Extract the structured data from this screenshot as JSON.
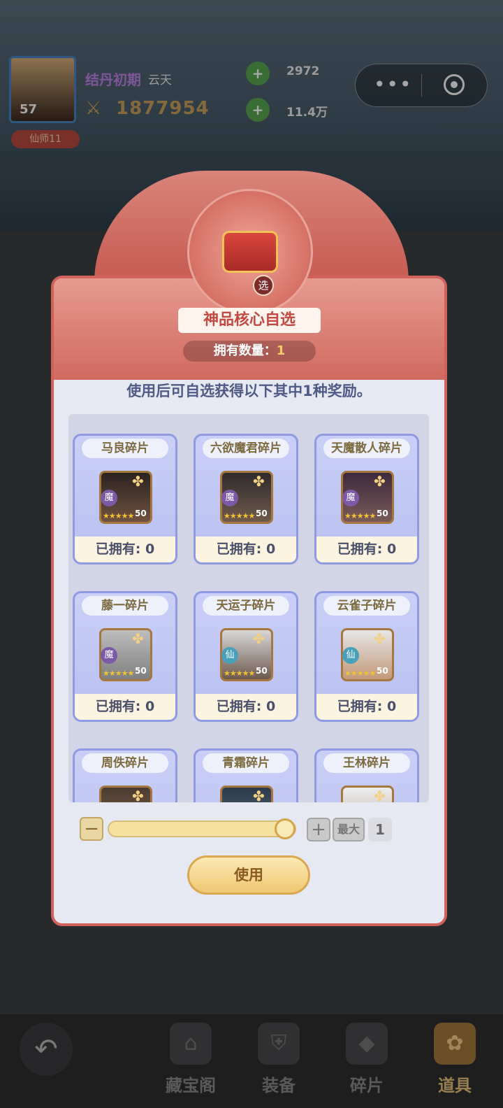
{
  "header": {
    "player_level": "57",
    "title_badge": "仙师11",
    "realm": "结丹初期",
    "player_name": "云天",
    "power": "1877954",
    "resource_1": "2972",
    "resource_2": "11.4万"
  },
  "modal": {
    "title": "神品核心自选",
    "chest_badge": "选",
    "owned_label": "拥有数量：",
    "owned_count": "1",
    "description": "使用后可自选获得以下其中1种奖励。",
    "items": [
      {
        "name": "马良碎片",
        "faction": "魔",
        "qty": "50",
        "owned": "已拥有: 0"
      },
      {
        "name": "六欲魔君碎片",
        "faction": "魔",
        "qty": "50",
        "owned": "已拥有: 0"
      },
      {
        "name": "天魔散人碎片",
        "faction": "魔",
        "qty": "50",
        "owned": "已拥有: 0"
      },
      {
        "name": "藤一碎片",
        "faction": "魔",
        "qty": "50",
        "owned": "已拥有: 0"
      },
      {
        "name": "天运子碎片",
        "faction": "仙",
        "qty": "50",
        "owned": "已拥有: 0"
      },
      {
        "name": "云雀子碎片",
        "faction": "仙",
        "qty": "50",
        "owned": "已拥有: 0"
      },
      {
        "name": "周佚碎片"
      },
      {
        "name": "青霜碎片"
      },
      {
        "name": "王林碎片"
      }
    ],
    "selector": {
      "minus": "−",
      "plus": "+",
      "max_label": "最大",
      "count": "1",
      "fraction": 1.0
    },
    "use_label": "使用"
  },
  "nav": {
    "items": [
      {
        "label": "藏宝阁",
        "icon": "pavilion-icon"
      },
      {
        "label": "装备",
        "icon": "armor-icon"
      },
      {
        "label": "碎片",
        "icon": "shard-icon"
      },
      {
        "label": "道具",
        "icon": "bag-icon"
      }
    ]
  },
  "colors": {
    "modal_border": "#d0615b",
    "card_border": "#8f9ae3",
    "accent_gold": "#efc873",
    "faction_mo": "#7c5aa8",
    "faction_xian": "#4aa0b8"
  }
}
